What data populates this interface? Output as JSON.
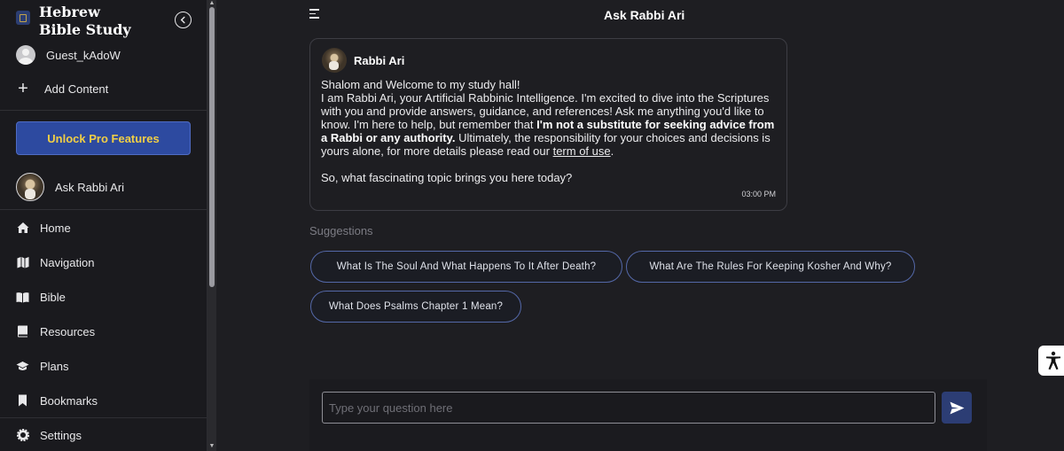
{
  "sidebar": {
    "brand_title": "Hebrew Bible Study",
    "user_name": "Guest_kAdoW",
    "add_content_label": "Add Content",
    "pro_button_label": "Unlock Pro Features",
    "rabbi_label": "Ask Rabbi Ari",
    "nav_items": [
      {
        "label": "Home",
        "icon": "home-icon"
      },
      {
        "label": "Navigation",
        "icon": "map-icon"
      },
      {
        "label": "Bible",
        "icon": "book-open-icon"
      },
      {
        "label": "Resources",
        "icon": "book-icon"
      },
      {
        "label": "Plans",
        "icon": "graduation-cap-icon"
      },
      {
        "label": "Bookmarks",
        "icon": "bookmark-icon"
      },
      {
        "label": "Settings",
        "icon": "gear-icon"
      }
    ]
  },
  "header": {
    "title": "Ask Rabbi Ari"
  },
  "message": {
    "sender": "Rabbi Ari",
    "line1": "Shalom and Welcome to my study hall!",
    "para_a": "I am Rabbi Ari, your Artificial Rabbinic Intelligence. I'm excited to dive into the Scriptures with you and provide answers, guidance, and references! Ask me anything you'd like to know. I'm here to help, but remember that ",
    "bold": "I'm not a substitute for seeking advice from a Rabbi or any authority.",
    "para_b": " Ultimately, the responsibility for your choices and decisions is yours alone, for more details please read our ",
    "link": "term of use",
    "para_end": ".",
    "question": "So, what fascinating topic brings you here today?",
    "time": "03:00 PM"
  },
  "suggestions": {
    "label": "Suggestions",
    "items": [
      "What Is The Soul And What Happens To It After Death?",
      "What Are The Rules For Keeping Kosher And Why?",
      "What Does Psalms Chapter 1 Mean?"
    ]
  },
  "input": {
    "placeholder": "Type your question here",
    "value": ""
  },
  "colors": {
    "accent": "#2d4aa0",
    "pro_text": "#f1cf45",
    "chip_border": "#5468a8",
    "background": "#1e1e22"
  }
}
